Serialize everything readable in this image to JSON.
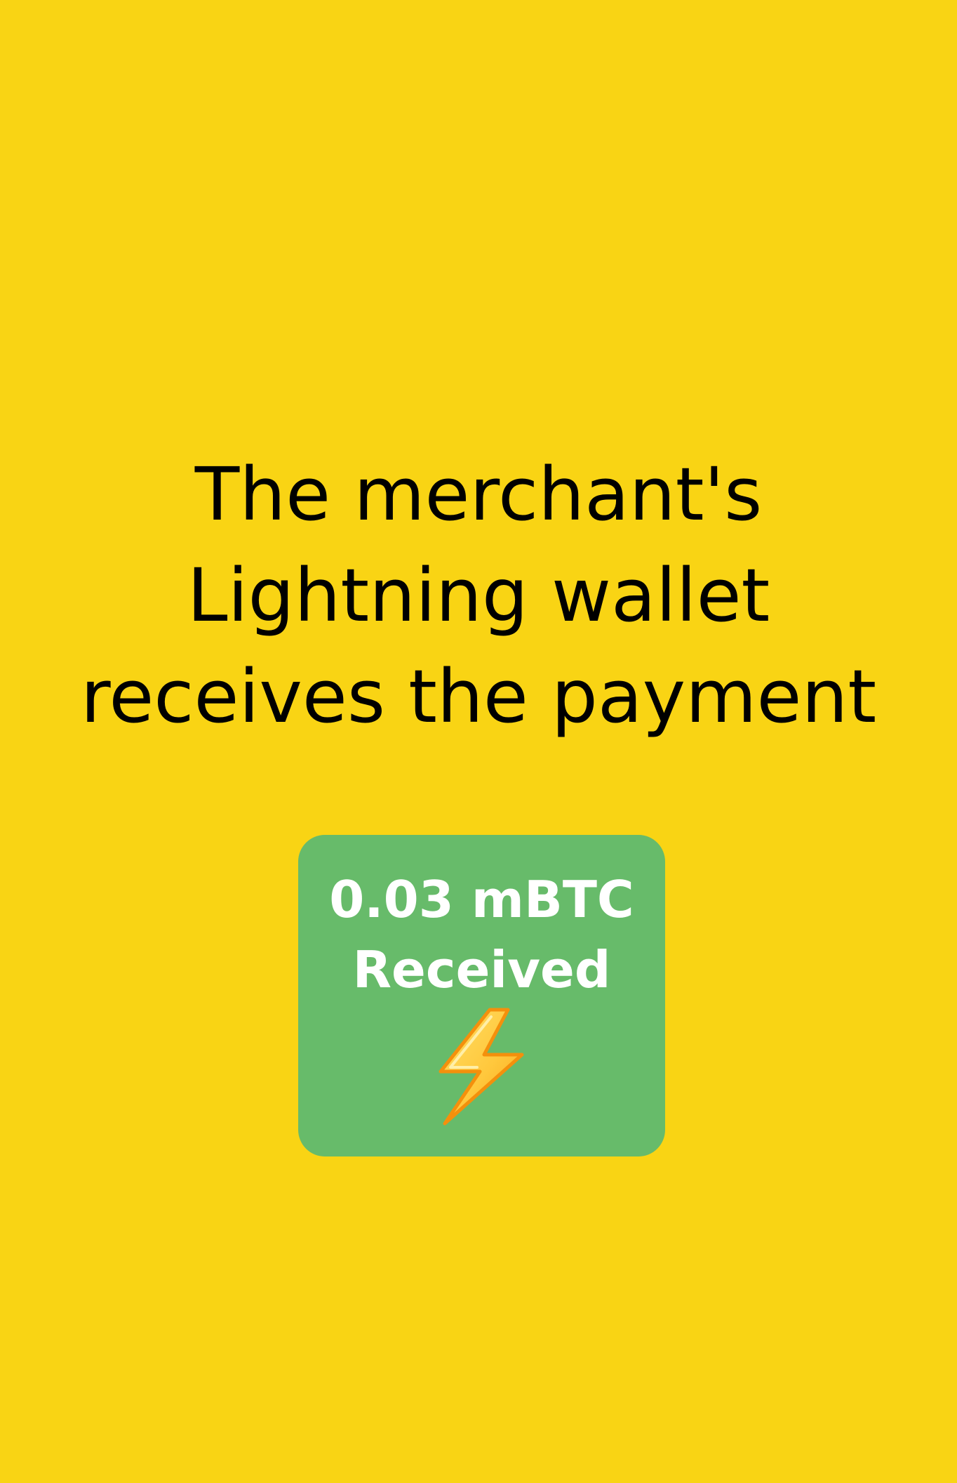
{
  "headline": {
    "lines": [
      "The merchant's",
      "Lightning wallet",
      "receives the payment"
    ]
  },
  "payment_card": {
    "amount": "0.03 mBTC",
    "status": "Received",
    "icon": "lightning-bolt-icon",
    "background_color": "#67BB6A",
    "text_color": "#FFFFFF"
  },
  "colors": {
    "page_background": "#F9D414",
    "headline_text": "#000000",
    "bolt_fill": "#FFC83D",
    "bolt_outline": "#F4900C"
  }
}
